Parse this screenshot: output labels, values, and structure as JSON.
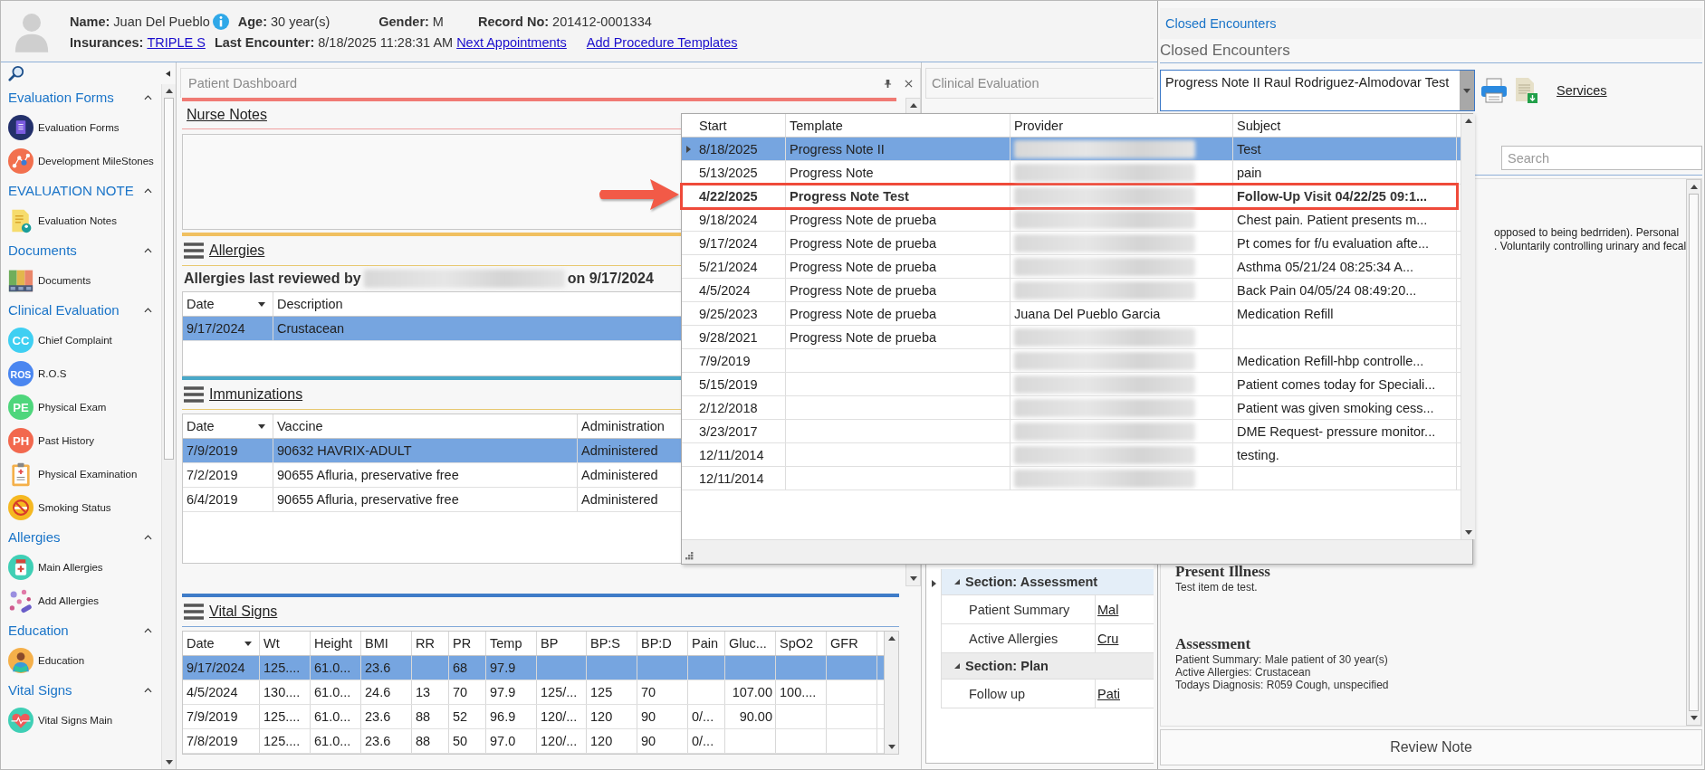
{
  "patient": {
    "name_label": "Name:",
    "name": "Juan Del Pueblo",
    "age_label": "Age:",
    "age": "30 year(s)",
    "gender_label": "Gender:",
    "gender": "M",
    "record_label": "Record No:",
    "record": "201412-0001334",
    "insurance_label": "Insurances:",
    "insurance": "TRIPLE S",
    "last_label": "Last Encounter:",
    "last": "8/18/2025 11:28:31 AM",
    "links": [
      "Next Appointments",
      "Add Procedure Templates"
    ]
  },
  "sidebar": {
    "groups": [
      {
        "title": "Evaluation Forms",
        "expanded": true,
        "items": [
          {
            "label": "Evaluation Forms",
            "kind": "forms"
          },
          {
            "label": "Development MileStones",
            "kind": "milestones"
          }
        ]
      },
      {
        "title": "EVALUATION NOTE",
        "expanded": true,
        "items": [
          {
            "label": "Evaluation Notes",
            "kind": "notes"
          }
        ]
      },
      {
        "title": "Documents",
        "expanded": true,
        "items": [
          {
            "label": "Documents",
            "kind": "binders"
          }
        ]
      },
      {
        "title": "Clinical Evaluation",
        "expanded": true,
        "items": [
          {
            "label": "Chief Complaint",
            "kind": "letters",
            "icon_text": "CC",
            "color": "#3fcff2"
          },
          {
            "label": "R.O.S",
            "kind": "letters",
            "icon_text": "ROS",
            "color": "#4a86f0"
          },
          {
            "label": "Physical Exam",
            "kind": "letters",
            "icon_text": "PE",
            "color": "#4ed67c"
          },
          {
            "label": "Past History",
            "kind": "letters",
            "icon_text": "PH",
            "color": "#f2684e"
          },
          {
            "label": "Physical Examination",
            "kind": "clipboard"
          },
          {
            "label": "Smoking Status",
            "kind": "nosmoking"
          }
        ]
      },
      {
        "title": "Allergies",
        "expanded": true,
        "items": [
          {
            "label": "Main Allergies",
            "kind": "bottle"
          },
          {
            "label": "Add Allergies",
            "kind": "pills"
          }
        ]
      },
      {
        "title": "Education",
        "expanded": true,
        "items": [
          {
            "label": "Education",
            "kind": "reader"
          }
        ]
      },
      {
        "title": "Vital Signs",
        "expanded": true,
        "items": [
          {
            "label": "Vital Signs Main",
            "kind": "heart"
          }
        ]
      }
    ]
  },
  "dashboard": {
    "title": "Patient Dashboard",
    "nurse_notes": "Nurse Notes",
    "allergies": {
      "title": "Allergies",
      "review_prefix": "Allergies last reviewed by",
      "review_suffix": "on 9/17/2024",
      "columns": [
        "Date",
        "Description"
      ],
      "rows": [
        {
          "cells": [
            "9/17/2024",
            "Crustacean"
          ],
          "selected": true
        }
      ]
    },
    "immunizations": {
      "title": "Immunizations",
      "columns": [
        "Date",
        "Vaccine",
        "Administration"
      ],
      "rows": [
        {
          "cells": [
            "7/9/2019",
            "90632 HAVRIX-ADULT",
            "Administered"
          ],
          "selected": true
        },
        {
          "cells": [
            "7/2/2019",
            "90655 Afluria, preservative free",
            "Administered"
          ],
          "selected": false
        },
        {
          "cells": [
            "6/4/2019",
            "90655 Afluria, preservative free",
            "Administered"
          ],
          "selected": false
        }
      ]
    },
    "vital_signs": {
      "title": "Vital Signs",
      "columns": [
        "Date",
        "Wt",
        "Height",
        "BMI",
        "RR",
        "PR",
        "Temp",
        "BP",
        "BP:S",
        "BP:D",
        "Pain",
        "Gluc...",
        "SpO2",
        "GFR"
      ],
      "rows": [
        {
          "cells": [
            "9/17/2024",
            "125....",
            "61.0...",
            "23.6",
            "",
            "68",
            "97.9",
            "",
            "",
            "",
            "",
            "",
            "",
            ""
          ],
          "selected": true
        },
        {
          "cells": [
            "4/5/2024",
            "130....",
            "61.0...",
            "24.6",
            "13",
            "70",
            "97.9",
            "125/...",
            "125",
            "70",
            "",
            "107.00",
            "100....",
            ""
          ],
          "selected": false
        },
        {
          "cells": [
            "7/9/2019",
            "125....",
            "61.0...",
            "23.6",
            "88",
            "52",
            "96.9",
            "120/...",
            "120",
            "90",
            "0/...",
            "90.00",
            "",
            ""
          ],
          "selected": false
        },
        {
          "cells": [
            "7/8/2019",
            "125....",
            "61.0...",
            "23.6",
            "88",
            "50",
            "97.0",
            "120/...",
            "120",
            "90",
            "0/...",
            "",
            "",
            ""
          ],
          "selected": false
        }
      ]
    }
  },
  "clinical": {
    "title": "Clinical Evaluation",
    "sections": [
      {
        "title": "Section: Assessment",
        "expanded": true,
        "rows": [
          {
            "label": "Patient Summary",
            "value": "Mal"
          },
          {
            "label": "Active Allergies",
            "value": "Cru"
          }
        ]
      },
      {
        "title": "Section: Plan",
        "expanded": true,
        "rows": [
          {
            "label": "Follow up",
            "value": "Pati"
          }
        ]
      }
    ]
  },
  "closed": {
    "tab": "Closed Encounters",
    "title": "Closed Encounters",
    "combo": {
      "value": "Progress Note II Raul Rodriguez-Almodovar Test",
      "expanded": true
    },
    "services": "Services",
    "search": {
      "placeholder": "Search"
    },
    "note": {
      "fragments": [
        "opposed to being bedrriden). Personal",
        ". Voluntarily controlling urinary and fecal"
      ],
      "sections": [
        {
          "heading": "Present Illness",
          "lines": [
            "Test item de test."
          ]
        },
        {
          "heading": "Assessment",
          "lines": [
            "Patient Summary: Male patient of 30 year(s)",
            "Active Allergies: Crustacean",
            "Todays Diagnosis: R059 Cough, unspecified"
          ]
        }
      ]
    },
    "review_button": "Review Note"
  },
  "encounters": {
    "columns": [
      "Start",
      "Template",
      "Provider",
      "Subject"
    ],
    "rows": [
      {
        "start": "8/18/2025",
        "template": "Progress Note II",
        "provider": "",
        "redacted": true,
        "subject": "Test",
        "selected": true,
        "highlighted": false
      },
      {
        "start": "5/13/2025",
        "template": "Progress Note",
        "provider": "",
        "redacted": true,
        "subject": "pain",
        "selected": false,
        "highlighted": false
      },
      {
        "start": "4/22/2025",
        "template": "Progress Note Test",
        "provider": "",
        "redacted": true,
        "subject": "Follow-Up Visit   04/22/25 09:1...",
        "selected": false,
        "highlighted": true
      },
      {
        "start": "9/18/2024",
        "template": "Progress Note de prueba",
        "provider": "",
        "redacted": true,
        "subject": "Chest pain. Patient presents m...",
        "selected": false,
        "highlighted": false
      },
      {
        "start": "9/17/2024",
        "template": "Progress Note de prueba",
        "provider": "",
        "redacted": true,
        "subject": "Pt comes for f/u evaluation afte...",
        "selected": false,
        "highlighted": false
      },
      {
        "start": "5/21/2024",
        "template": "Progress Note de prueba",
        "provider": "",
        "redacted": true,
        "subject": "Asthma   05/21/24 08:25:34 A...",
        "selected": false,
        "highlighted": false
      },
      {
        "start": "4/5/2024",
        "template": "Progress Note de prueba",
        "provider": "",
        "redacted": true,
        "subject": "Back Pain   04/05/24 08:49:20...",
        "selected": false,
        "highlighted": false
      },
      {
        "start": "9/25/2023",
        "template": "Progress Note de prueba",
        "provider": "Juana Del Pueblo Garcia",
        "redacted": false,
        "subject": "Medication Refill",
        "selected": false,
        "highlighted": false
      },
      {
        "start": "9/28/2021",
        "template": "Progress Note de prueba",
        "provider": "",
        "redacted": true,
        "subject": "",
        "selected": false,
        "highlighted": false
      },
      {
        "start": "7/9/2019",
        "template": "",
        "provider": "",
        "redacted": true,
        "subject": "Medication Refill-hbp controlle...",
        "selected": false,
        "highlighted": false
      },
      {
        "start": "5/15/2019",
        "template": "",
        "provider": "",
        "redacted": true,
        "subject": "Patient comes today for Speciali...",
        "selected": false,
        "highlighted": false
      },
      {
        "start": "2/12/2018",
        "template": "",
        "provider": "",
        "redacted": true,
        "subject": "Patient was given smoking cess...",
        "selected": false,
        "highlighted": false
      },
      {
        "start": "3/23/2017",
        "template": "",
        "provider": "",
        "redacted": true,
        "subject": "DME Request- pressure monitor...",
        "selected": false,
        "highlighted": false
      },
      {
        "start": "12/11/2014",
        "template": "",
        "provider": "",
        "redacted": true,
        "subject": "testing.",
        "selected": false,
        "highlighted": false
      },
      {
        "start": "12/11/2014",
        "template": "",
        "provider": "",
        "redacted": true,
        "subject": "",
        "selected": false,
        "highlighted": false
      }
    ]
  }
}
